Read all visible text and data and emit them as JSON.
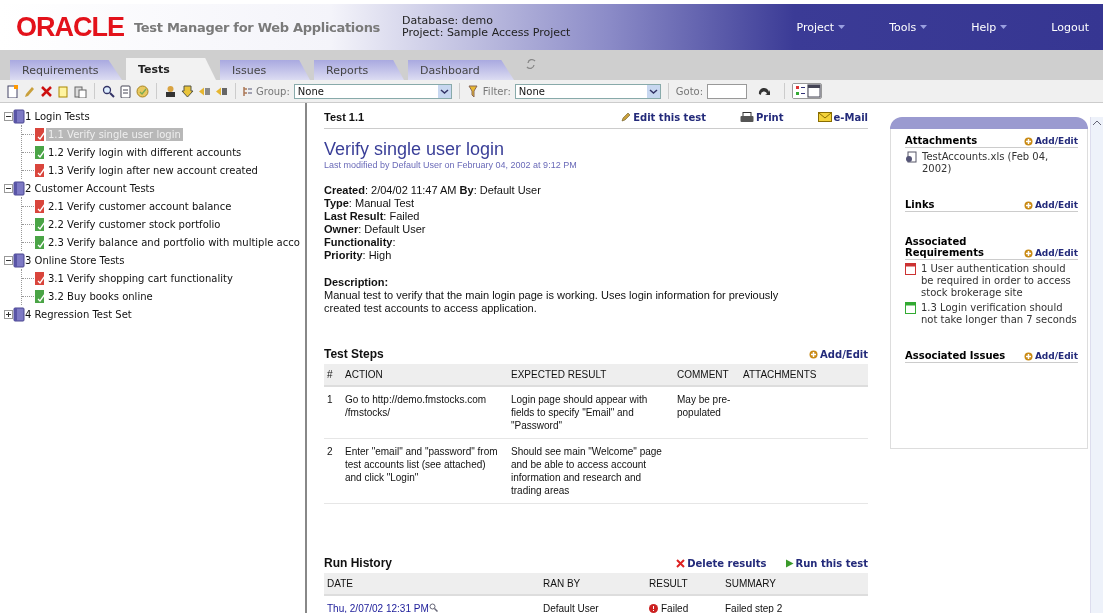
{
  "header": {
    "logo": "ORACLE",
    "app_title": "Test Manager for Web Applications",
    "database": "Database: demo",
    "project": "Project: Sample Access Project",
    "menu": [
      {
        "label": "Project",
        "dropdown": true
      },
      {
        "label": "Tools",
        "dropdown": true
      },
      {
        "label": "Help",
        "dropdown": true
      },
      {
        "label": "Logout",
        "dropdown": false
      }
    ]
  },
  "tabs": [
    {
      "label": "Requirements",
      "selected": false
    },
    {
      "label": "Tests",
      "selected": true
    },
    {
      "label": "Issues",
      "selected": false
    },
    {
      "label": "Reports",
      "selected": false
    },
    {
      "label": "Dashboard",
      "selected": false
    }
  ],
  "toolbar": {
    "group_label": "Group:",
    "group_value": "None",
    "filter_label": "Filter:",
    "filter_value": "None",
    "goto_label": "Goto:"
  },
  "tree": [
    {
      "label": "1 Login Tests",
      "expanded": true,
      "children": [
        {
          "label": "1.1 Verify single user login",
          "passed": false,
          "selected": true
        },
        {
          "label": "1.2 Verify login with different accounts",
          "passed": true,
          "selected": false
        },
        {
          "label": "1.3 Verify login after new account created",
          "passed": false,
          "selected": false
        }
      ]
    },
    {
      "label": "2 Customer Account Tests",
      "expanded": true,
      "children": [
        {
          "label": "2.1 Verify customer account balance",
          "passed": false,
          "selected": false
        },
        {
          "label": "2.2 Verify customer stock portfolio",
          "passed": true,
          "selected": false
        },
        {
          "label": "2.3 Verify balance and portfolio with multiple acco",
          "passed": true,
          "selected": false
        }
      ]
    },
    {
      "label": "3 Online Store Tests",
      "expanded": true,
      "children": [
        {
          "label": "3.1 Verify shopping cart functionality",
          "passed": false,
          "selected": false
        },
        {
          "label": "3.2 Buy books online",
          "passed": true,
          "selected": false
        }
      ]
    },
    {
      "label": "4 Regression Test Set",
      "expanded": false
    }
  ],
  "detail": {
    "heading": "Test 1.1",
    "actions": [
      {
        "kind": "edit",
        "label": "Edit this test"
      },
      {
        "kind": "print",
        "label": "Print"
      },
      {
        "kind": "mail",
        "label": "e-Mail"
      }
    ],
    "title": "Verify single user login",
    "modified": "Last modified by Default User on February 04, 2002 at 9:12 PM",
    "fields": [
      "**Created**: 2/04/02 11:47 AM **By**: Default User",
      "**Type**: Manual Test",
      "**Last Result**: Failed",
      "**Owner**: Default User",
      "**Functionality**:",
      "**Priority**: High"
    ],
    "description_label": "Description:",
    "description": "Manual test to verify that the main login page is working. Uses login information for previously created test accounts to access application.",
    "steps": {
      "title": "Test Steps",
      "action": "Add/Edit",
      "columns": [
        "#",
        "ACTION",
        "EXPECTED RESULT",
        "COMMENT",
        "ATTACHMENTS"
      ],
      "rows": [
        [
          "1",
          "Go to http://demo.fmstocks.com /fmstocks/",
          "Login page should appear with fields to specify \"Email\" and \"Password\"",
          "May be pre-populated"
        ],
        [
          "2",
          "Enter \"email\" and \"password\" from test accounts list (see attached) and click \"Login\"",
          "Should see main \"Welcome\" page and be able to access account information and research and trading areas",
          ""
        ]
      ]
    },
    "history": {
      "title": "Run History",
      "actions": [
        {
          "kind": "delete",
          "label": "Delete results"
        },
        {
          "kind": "run",
          "label": "Run this test"
        }
      ],
      "columns": [
        "DATE",
        "RAN BY",
        "RESULT",
        "SUMMARY"
      ],
      "rows": [
        {
          "date": "Thu, 2/07/02 12:31 PM",
          "ran_by": "Default User",
          "result": "Failed",
          "passed": false,
          "summary": "Failed step 2"
        }
      ]
    }
  },
  "side": [
    {
      "title": "Attachments",
      "action": "Add/Edit",
      "items": [
        {
          "kind": "file",
          "text": "TestAccounts.xls (Feb 04, 2002)"
        }
      ]
    },
    {
      "title": "Links",
      "action": "Add/Edit"
    },
    {
      "title": "Associated Requirements",
      "action": "Add/Edit",
      "items": [
        {
          "kind": "requirement",
          "text": "1 User authentication should be required in order to access stock brokerage site",
          "passed": false
        },
        {
          "kind": "requirement",
          "text": "1.3 Login verification should not take longer than 7 seconds",
          "passed": true
        }
      ]
    },
    {
      "title": "Associated Issues",
      "action": "Add/Edit"
    }
  ]
}
